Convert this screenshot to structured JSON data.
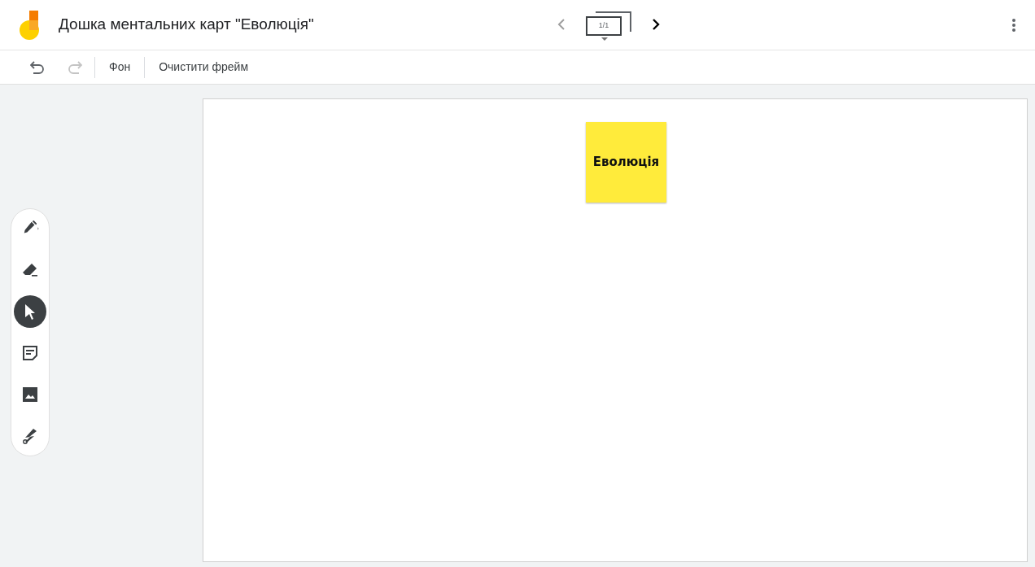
{
  "header": {
    "title": "Дошка ментальних карт \"Еволюція\"",
    "frame_counter": "1/1",
    "prev_disabled": true,
    "next_disabled": false
  },
  "toolbar": {
    "undo_disabled": false,
    "redo_disabled": true,
    "buttons": [
      "Фон",
      "Очистити фрейм"
    ]
  },
  "tools": [
    {
      "kind": "pen",
      "selected": false
    },
    {
      "kind": "eraser",
      "selected": false
    },
    {
      "kind": "select",
      "selected": true
    },
    {
      "kind": "sticky-note",
      "selected": false
    },
    {
      "kind": "image",
      "selected": false
    },
    {
      "kind": "laser",
      "selected": false
    }
  ],
  "canvas": {
    "notes": [
      {
        "text": "Еволюція"
      }
    ]
  }
}
